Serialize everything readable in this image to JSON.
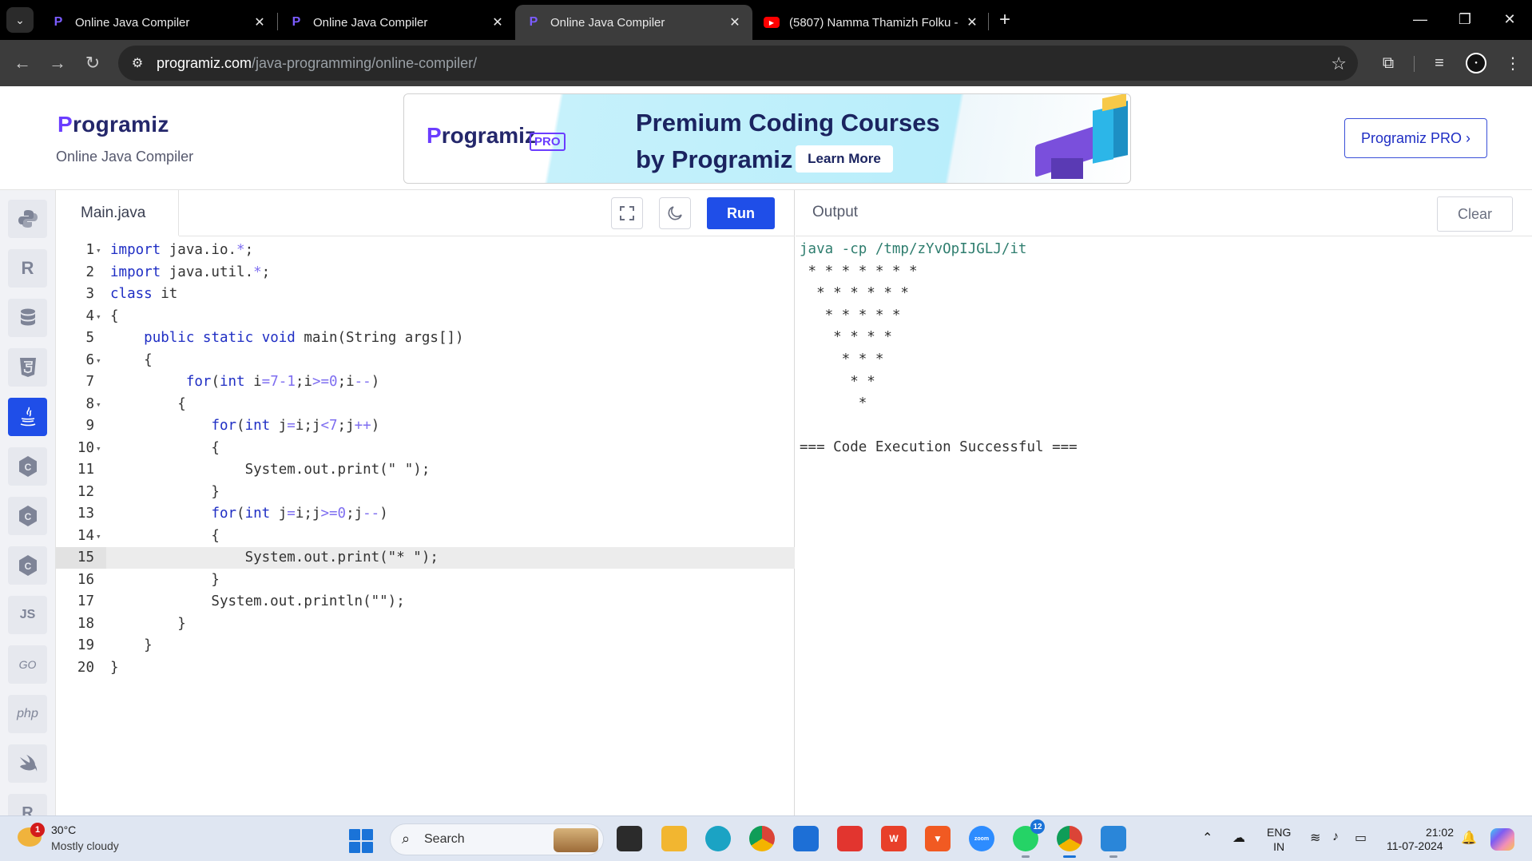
{
  "browser": {
    "tabs": [
      {
        "title": "Online Java Compiler",
        "favicon": "programiz-icon",
        "active": false
      },
      {
        "title": "Online Java Compiler",
        "favicon": "programiz-icon",
        "active": false
      },
      {
        "title": "Online Java Compiler",
        "favicon": "programiz-icon",
        "active": true
      },
      {
        "title": "(5807) Namma Thamizh Folku -",
        "favicon": "youtube-icon",
        "active": false
      }
    ],
    "url_host": "programiz.com",
    "url_path": "/java-programming/online-compiler/"
  },
  "header": {
    "logo": "rogramiz",
    "logo_p": "P",
    "subtitle": "Online Java Compiler",
    "pro_button": "Programiz PRO ›"
  },
  "ad": {
    "logo": "rogramiz",
    "logo_p": "P",
    "pro_badge": "PRO",
    "line1": "Premium Coding Courses",
    "line2": "by Programiz",
    "cta": "Learn More"
  },
  "sidebar": {
    "languages": [
      {
        "name": "python",
        "icon": "python-icon",
        "active": false
      },
      {
        "name": "r",
        "icon": "r-icon",
        "active": false
      },
      {
        "name": "sql",
        "icon": "database-icon",
        "active": false
      },
      {
        "name": "html",
        "icon": "html5-icon",
        "active": false
      },
      {
        "name": "java",
        "icon": "java-icon",
        "active": true
      },
      {
        "name": "c",
        "icon": "c-icon",
        "active": false
      },
      {
        "name": "csharp",
        "icon": "csharp-icon",
        "active": false
      },
      {
        "name": "cpp",
        "icon": "cpp-icon",
        "active": false
      },
      {
        "name": "js",
        "icon": "js-icon",
        "label": "JS",
        "active": false
      },
      {
        "name": "go",
        "icon": "go-icon",
        "label": "GO",
        "active": false
      },
      {
        "name": "php",
        "icon": "php-icon",
        "label": "php",
        "active": false
      },
      {
        "name": "swift",
        "icon": "swift-icon",
        "active": false
      },
      {
        "name": "rust",
        "icon": "rust-icon",
        "active": false
      }
    ]
  },
  "editor": {
    "file_name": "Main.java",
    "run_label": "Run",
    "highlighted_line": 15,
    "lines": [
      "import java.io.*;",
      "import java.util.*;",
      "class it",
      "{",
      "    public static void main(String args[])",
      "    {",
      "         for(int i=7-1;i>=0;i--)",
      "        {",
      "            for(int j=i;j<7;j++)",
      "            {",
      "                System.out.print(\" \");",
      "            }",
      "            for(int j=i;j>=0;j--)",
      "            {",
      "                System.out.print(\"* \");",
      "            }",
      "            System.out.println(\"\");",
      "        }",
      "    }",
      "}"
    ],
    "foldable_lines": [
      1,
      4,
      6,
      8,
      10,
      14
    ]
  },
  "output": {
    "title": "Output",
    "clear_label": "Clear",
    "command": "java -cp /tmp/zYvOpIJGLJ/it",
    "lines": [
      " * * * * * * * ",
      "  * * * * * * ",
      "   * * * * * ",
      "    * * * * ",
      "     * * * ",
      "      * * ",
      "       * ",
      "",
      "=== Code Execution Successful ==="
    ]
  },
  "taskbar": {
    "weather_temp": "30°C",
    "weather_desc": "Mostly cloudy",
    "weather_badge": "1",
    "search_placeholder": "Search",
    "whatsapp_badge": "12",
    "lang_line1": "ENG",
    "lang_line2": "IN",
    "time": "21:02",
    "date": "11-07-2024"
  },
  "colors": {
    "accent": "#1f4ee8",
    "brand_purple": "#6b3dff",
    "brand_navy": "#24276b"
  }
}
